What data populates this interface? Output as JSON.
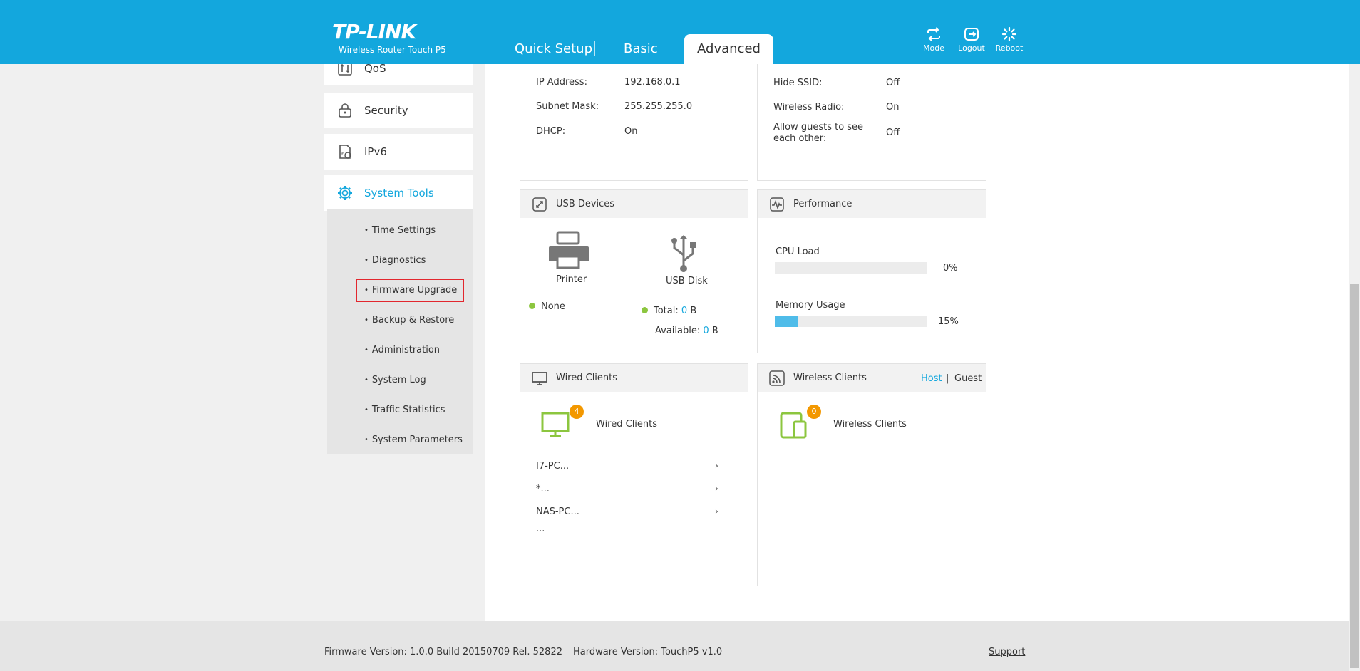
{
  "header": {
    "brand": "TP-LINK",
    "model": "Wireless Router Touch P5",
    "tabs": [
      {
        "label": "Quick Setup",
        "active": false
      },
      {
        "label": "Basic",
        "active": false
      },
      {
        "label": "Advanced",
        "active": true
      }
    ],
    "tools": [
      {
        "label": "Mode",
        "icon": "mode-icon"
      },
      {
        "label": "Logout",
        "icon": "logout-icon"
      },
      {
        "label": "Reboot",
        "icon": "reboot-icon"
      }
    ],
    "color": "#13a7dd"
  },
  "sidebar": {
    "items": [
      {
        "label": "QoS",
        "icon": "qos-icon"
      },
      {
        "label": "Security",
        "icon": "lock-icon"
      },
      {
        "label": "IPv6",
        "icon": "ipv6-icon"
      },
      {
        "label": "System Tools",
        "icon": "gear-icon",
        "active": true
      }
    ],
    "subitems": [
      {
        "label": "Time Settings"
      },
      {
        "label": "Diagnostics"
      },
      {
        "label": "Firmware Upgrade",
        "highlighted": true
      },
      {
        "label": "Backup & Restore"
      },
      {
        "label": "Administration"
      },
      {
        "label": "System Log"
      },
      {
        "label": "Traffic Statistics"
      },
      {
        "label": "System Parameters"
      }
    ]
  },
  "network": {
    "ip_label": "IP Address:",
    "ip_value": "192.168.0.1",
    "mask_label": "Subnet Mask:",
    "mask_value": "255.255.255.0",
    "dhcp_label": "DHCP:",
    "dhcp_value": "On"
  },
  "guest": {
    "hide_ssid_label": "Hide SSID:",
    "hide_ssid_value": "Off",
    "radio_label": "Wireless Radio:",
    "radio_value": "On",
    "allow_label_1": "Allow guests to see",
    "allow_label_2": "each other:",
    "allow_value": "Off"
  },
  "usb": {
    "title": "USB Devices",
    "printer_label": "Printer",
    "printer_status": "None",
    "disk_label": "USB Disk",
    "total_label": "Total:",
    "total_value": "0",
    "available_label": "Available:",
    "available_value": "0",
    "unit": "B"
  },
  "performance": {
    "title": "Performance",
    "cpu_label": "CPU Load",
    "cpu_value": "0%",
    "cpu_fraction": 0,
    "mem_label": "Memory Usage",
    "mem_value": "15%",
    "mem_fraction": 0.15
  },
  "wired": {
    "title": "Wired Clients",
    "label": "Wired Clients",
    "count": "4",
    "clients": [
      "I7-PC...",
      "*...",
      "NAS-PC..."
    ],
    "more": "..."
  },
  "wireless": {
    "title": "Wireless Clients",
    "label": "Wireless Clients",
    "count": "0",
    "host": "Host",
    "separator": "|",
    "guest": "Guest"
  },
  "footer": {
    "firmware": "Firmware Version: 1.0.0 Build 20150709 Rel. 52822",
    "hardware": "Hardware Version: TouchP5 v1.0",
    "support": "Support"
  }
}
